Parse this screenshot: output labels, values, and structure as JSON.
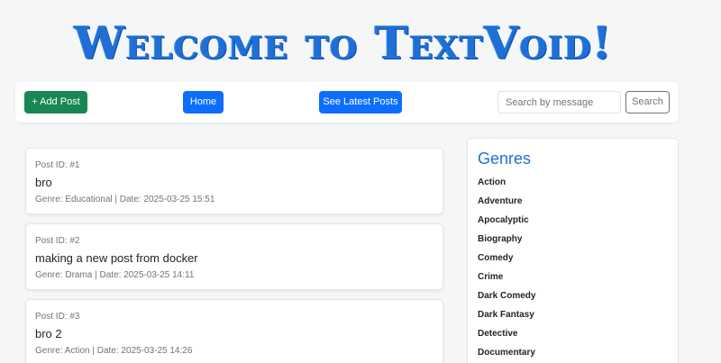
{
  "site": {
    "title": "Welcome to TextVoid!"
  },
  "toolbar": {
    "add_label": "+ Add Post",
    "home_label": "Home",
    "latest_label": "See Latest Posts",
    "search_placeholder": "Search by message",
    "search_value": "",
    "search_button": "Search"
  },
  "posts": [
    {
      "id_label": "Post ID: #1",
      "message": "bro",
      "meta": "Genre: Educational | Date: 2025-03-25 15:51"
    },
    {
      "id_label": "Post ID: #2",
      "message": "making a new post from docker",
      "meta": "Genre: Drama | Date: 2025-03-25 14:11"
    },
    {
      "id_label": "Post ID: #3",
      "message": "bro 2",
      "meta": "Genre: Action | Date: 2025-03-25 14:26"
    }
  ],
  "sidebar": {
    "title": "Genres",
    "items": [
      "Action",
      "Adventure",
      "Apocalyptic",
      "Biography",
      "Comedy",
      "Crime",
      "Dark Comedy",
      "Dark Fantasy",
      "Detective",
      "Documentary"
    ]
  },
  "colors": {
    "brand": "#1f6fd6",
    "primary": "#0d6efd",
    "success": "#198754",
    "muted": "#6c757d"
  }
}
